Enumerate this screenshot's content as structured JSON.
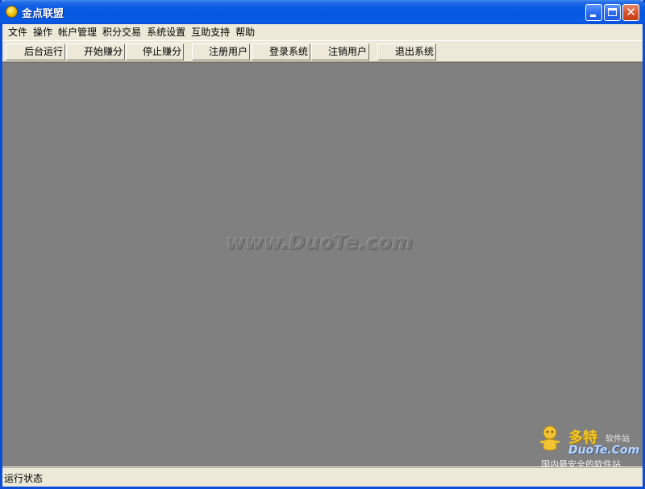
{
  "window": {
    "title": "金点联盟",
    "icon": "gold-coin-icon"
  },
  "title_buttons": {
    "minimize": "minimize-icon",
    "maximize": "maximize-icon",
    "close": "close-icon"
  },
  "menu": {
    "items": [
      "文件",
      "操作",
      "帐户管理",
      "积分交易",
      "系统设置",
      "互助支持",
      "帮助"
    ]
  },
  "toolbar": {
    "buttons": [
      "后台运行",
      "开始赚分",
      "停止赚分",
      "注册用户",
      "登录系统",
      "注销用户",
      "退出系统"
    ]
  },
  "content": {
    "watermark": "www.DuoTe.com",
    "logo": {
      "name": "多特",
      "sub": "软件站",
      "domain": "DuoTe.Com",
      "slogan": "国内最安全的软件站"
    }
  },
  "status": {
    "text": "运行状态"
  },
  "colors": {
    "titlebar": "#0a5ce4",
    "workspace": "#808080",
    "chrome": "#ece9d8"
  }
}
